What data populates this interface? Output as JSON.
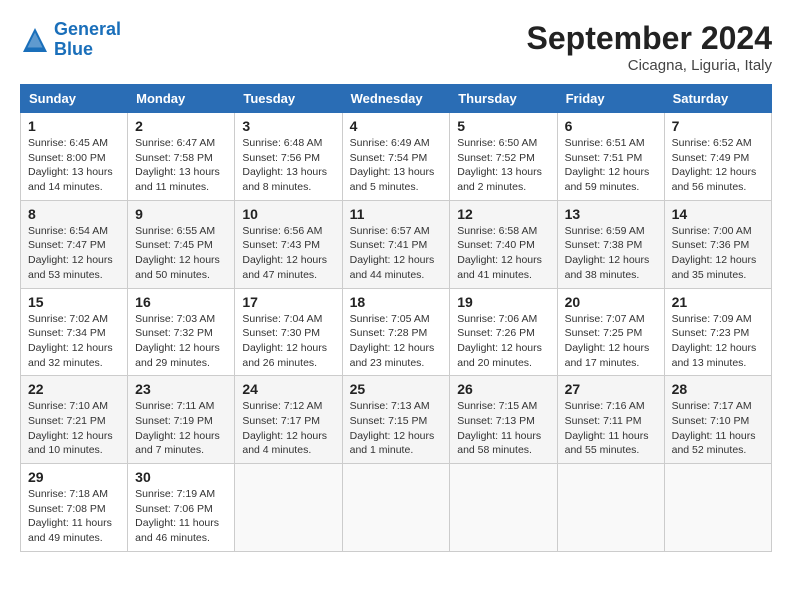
{
  "logo": {
    "line1": "General",
    "line2": "Blue"
  },
  "title": "September 2024",
  "location": "Cicagna, Liguria, Italy",
  "days_of_week": [
    "Sunday",
    "Monday",
    "Tuesday",
    "Wednesday",
    "Thursday",
    "Friday",
    "Saturday"
  ],
  "weeks": [
    [
      {
        "day": "1",
        "info": "Sunrise: 6:45 AM\nSunset: 8:00 PM\nDaylight: 13 hours\nand 14 minutes."
      },
      {
        "day": "2",
        "info": "Sunrise: 6:47 AM\nSunset: 7:58 PM\nDaylight: 13 hours\nand 11 minutes."
      },
      {
        "day": "3",
        "info": "Sunrise: 6:48 AM\nSunset: 7:56 PM\nDaylight: 13 hours\nand 8 minutes."
      },
      {
        "day": "4",
        "info": "Sunrise: 6:49 AM\nSunset: 7:54 PM\nDaylight: 13 hours\nand 5 minutes."
      },
      {
        "day": "5",
        "info": "Sunrise: 6:50 AM\nSunset: 7:52 PM\nDaylight: 13 hours\nand 2 minutes."
      },
      {
        "day": "6",
        "info": "Sunrise: 6:51 AM\nSunset: 7:51 PM\nDaylight: 12 hours\nand 59 minutes."
      },
      {
        "day": "7",
        "info": "Sunrise: 6:52 AM\nSunset: 7:49 PM\nDaylight: 12 hours\nand 56 minutes."
      }
    ],
    [
      {
        "day": "8",
        "info": "Sunrise: 6:54 AM\nSunset: 7:47 PM\nDaylight: 12 hours\nand 53 minutes."
      },
      {
        "day": "9",
        "info": "Sunrise: 6:55 AM\nSunset: 7:45 PM\nDaylight: 12 hours\nand 50 minutes."
      },
      {
        "day": "10",
        "info": "Sunrise: 6:56 AM\nSunset: 7:43 PM\nDaylight: 12 hours\nand 47 minutes."
      },
      {
        "day": "11",
        "info": "Sunrise: 6:57 AM\nSunset: 7:41 PM\nDaylight: 12 hours\nand 44 minutes."
      },
      {
        "day": "12",
        "info": "Sunrise: 6:58 AM\nSunset: 7:40 PM\nDaylight: 12 hours\nand 41 minutes."
      },
      {
        "day": "13",
        "info": "Sunrise: 6:59 AM\nSunset: 7:38 PM\nDaylight: 12 hours\nand 38 minutes."
      },
      {
        "day": "14",
        "info": "Sunrise: 7:00 AM\nSunset: 7:36 PM\nDaylight: 12 hours\nand 35 minutes."
      }
    ],
    [
      {
        "day": "15",
        "info": "Sunrise: 7:02 AM\nSunset: 7:34 PM\nDaylight: 12 hours\nand 32 minutes."
      },
      {
        "day": "16",
        "info": "Sunrise: 7:03 AM\nSunset: 7:32 PM\nDaylight: 12 hours\nand 29 minutes."
      },
      {
        "day": "17",
        "info": "Sunrise: 7:04 AM\nSunset: 7:30 PM\nDaylight: 12 hours\nand 26 minutes."
      },
      {
        "day": "18",
        "info": "Sunrise: 7:05 AM\nSunset: 7:28 PM\nDaylight: 12 hours\nand 23 minutes."
      },
      {
        "day": "19",
        "info": "Sunrise: 7:06 AM\nSunset: 7:26 PM\nDaylight: 12 hours\nand 20 minutes."
      },
      {
        "day": "20",
        "info": "Sunrise: 7:07 AM\nSunset: 7:25 PM\nDaylight: 12 hours\nand 17 minutes."
      },
      {
        "day": "21",
        "info": "Sunrise: 7:09 AM\nSunset: 7:23 PM\nDaylight: 12 hours\nand 13 minutes."
      }
    ],
    [
      {
        "day": "22",
        "info": "Sunrise: 7:10 AM\nSunset: 7:21 PM\nDaylight: 12 hours\nand 10 minutes."
      },
      {
        "day": "23",
        "info": "Sunrise: 7:11 AM\nSunset: 7:19 PM\nDaylight: 12 hours\nand 7 minutes."
      },
      {
        "day": "24",
        "info": "Sunrise: 7:12 AM\nSunset: 7:17 PM\nDaylight: 12 hours\nand 4 minutes."
      },
      {
        "day": "25",
        "info": "Sunrise: 7:13 AM\nSunset: 7:15 PM\nDaylight: 12 hours\nand 1 minute."
      },
      {
        "day": "26",
        "info": "Sunrise: 7:15 AM\nSunset: 7:13 PM\nDaylight: 11 hours\nand 58 minutes."
      },
      {
        "day": "27",
        "info": "Sunrise: 7:16 AM\nSunset: 7:11 PM\nDaylight: 11 hours\nand 55 minutes."
      },
      {
        "day": "28",
        "info": "Sunrise: 7:17 AM\nSunset: 7:10 PM\nDaylight: 11 hours\nand 52 minutes."
      }
    ],
    [
      {
        "day": "29",
        "info": "Sunrise: 7:18 AM\nSunset: 7:08 PM\nDaylight: 11 hours\nand 49 minutes."
      },
      {
        "day": "30",
        "info": "Sunrise: 7:19 AM\nSunset: 7:06 PM\nDaylight: 11 hours\nand 46 minutes."
      },
      {
        "day": "",
        "info": ""
      },
      {
        "day": "",
        "info": ""
      },
      {
        "day": "",
        "info": ""
      },
      {
        "day": "",
        "info": ""
      },
      {
        "day": "",
        "info": ""
      }
    ]
  ]
}
